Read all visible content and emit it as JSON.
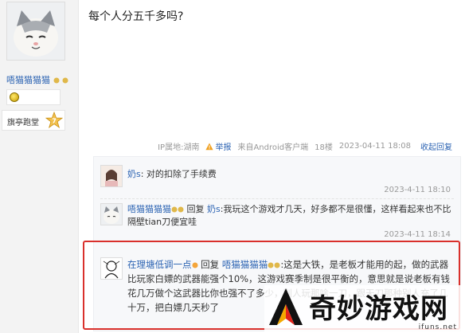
{
  "author": {
    "username": "唔猫猫猫猫",
    "rank_label": "旗亭跑堂",
    "rank_level": "7"
  },
  "post": {
    "text": "每个人分五千多吗?",
    "meta": {
      "ip": "IP属地:湖南",
      "report": "举报",
      "client": "来自Android客户端",
      "floor": "18楼",
      "time": "2023-04-11 18:08",
      "reply_link": "收起回复"
    }
  },
  "replies": [
    {
      "user": "奶s",
      "content": ": 对的扣除了手续费",
      "time": "2023-4-11 18:10"
    },
    {
      "user": "唔猫猫猫猫",
      "reply_word": "回复",
      "reply_to": "奶s",
      "content": ":我玩这个游戏才几天，好多都不是很懂，这样看起来也不比隔壁tian刀便宜哇",
      "time": "2023-4-11 18:14"
    },
    {
      "user": "在理塘低调一点",
      "reply_word": "回复",
      "reply_to": "唔猫猫猫猫",
      "content": ":这是大铁，是老板才能用的起，做的武器比玩家白嫖的武器能强个10%，这游戏赛季制是很平衡的，意思就是说老板有钱花几万做个这武器比你也强不了多少，别人玩那啥一刀，跟天刀那种别人充了几十万，把白嫖几天秒了"
    }
  ],
  "watermark": {
    "brand": "奇妙游戏网",
    "url": "ifuns.net"
  },
  "colors": {
    "link": "#2d64b3",
    "highlight": "#d9302c",
    "muted": "#999999"
  }
}
